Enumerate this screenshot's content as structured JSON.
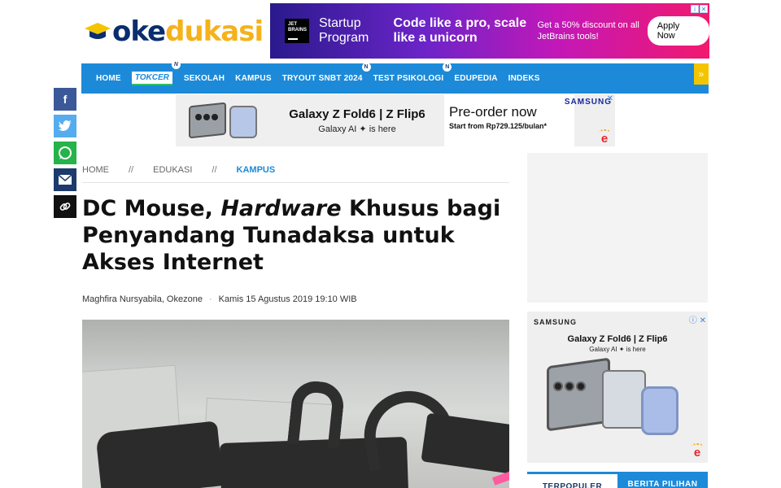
{
  "logo": {
    "part1": "oke",
    "part2": "dukasi"
  },
  "top_ad": {
    "brand": "JET BRAINS",
    "line1": "Startup Program",
    "line2": "Code like a pro, scale like a unicorn",
    "line3": "Get a 50% discount on all JetBrains tools!",
    "cta": "Apply Now"
  },
  "nav": {
    "items": [
      "HOME",
      "TOKCER",
      "SEKOLAH",
      "KAMPUS",
      "TRYOUT SNBT 2024",
      "TEST PSIKOLOGI",
      "EDUPEDIA",
      "INDEKS"
    ],
    "badge": "N",
    "more": "»"
  },
  "samsung_banner": {
    "headline": "Galaxy Z Fold6 | Z Flip6",
    "sub": "Galaxy AI ✦ is here",
    "cta_title": "Pre-order now",
    "cta_price": "Start from Rp729.125/bulan*",
    "brand": "SAMSUNG"
  },
  "breadcrumb": {
    "home": "HOME",
    "sep": "//",
    "section": "EDUKASI",
    "current": "KAMPUS"
  },
  "article": {
    "title_a": "DC Mouse, ",
    "title_em": "Hardware",
    "title_b": " Khusus bagi Penyandang Tunadaksa untuk Akses Internet",
    "author": "Maghfira Nursyabila, Okezone",
    "date": "Kamis 15 Agustus 2019 19:10 WIB"
  },
  "side_ad": {
    "brand": "SAMSUNG",
    "headline": "Galaxy Z Fold6 | Z Flip6",
    "sub": "Galaxy AI ✦ is here"
  },
  "tabs": [
    "TERPOPULER",
    "BERITA PILIHAN"
  ]
}
